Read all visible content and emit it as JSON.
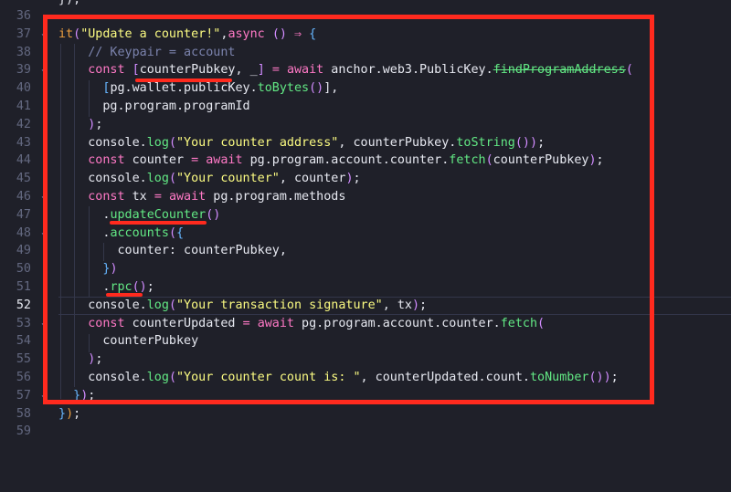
{
  "editor": {
    "partial_top": "});",
    "lines": [
      {
        "n": "36",
        "t": []
      },
      {
        "n": "37",
        "t": [
          [
            "pb",
            "it"
          ],
          [
            "pp",
            "("
          ],
          [
            "str",
            "\"Update a counter!\""
          ],
          [
            "",
            ","
          ],
          [
            "kw",
            "async"
          ],
          [
            "",
            " "
          ],
          [
            "pp",
            "()"
          ],
          [
            "",
            " "
          ],
          [
            "kw",
            "⇒"
          ],
          [
            "",
            " "
          ],
          [
            "pbl",
            "{"
          ]
        ]
      },
      {
        "n": "38",
        "t": [
          [
            "",
            "    "
          ],
          [
            "cm",
            "// Keypair = account"
          ]
        ]
      },
      {
        "n": "39",
        "t": [
          [
            "",
            "    "
          ],
          [
            "kw",
            "const"
          ],
          [
            "",
            " "
          ],
          [
            "pp",
            "["
          ],
          [
            "",
            "counterPubkey, _"
          ],
          [
            "pp",
            "]"
          ],
          [
            "",
            " "
          ],
          [
            "kw",
            "="
          ],
          [
            "",
            " "
          ],
          [
            "kw",
            "await"
          ],
          [
            "",
            " anchor.web3.PublicKey."
          ],
          [
            "fn strike",
            "findProgramAddress"
          ],
          [
            "pp",
            "("
          ]
        ]
      },
      {
        "n": "40",
        "t": [
          [
            "",
            "      "
          ],
          [
            "pbl",
            "["
          ],
          [
            "",
            "pg.wallet.publicKey."
          ],
          [
            "fn",
            "toBytes"
          ],
          [
            "pp",
            "()"
          ],
          [
            "",
            "],"
          ]
        ]
      },
      {
        "n": "41",
        "t": [
          [
            "",
            "      pg.program.programId"
          ]
        ]
      },
      {
        "n": "42",
        "t": [
          [
            "",
            "    "
          ],
          [
            "pp",
            ")"
          ],
          [
            "",
            ";"
          ]
        ]
      },
      {
        "n": "43",
        "t": [
          [
            "",
            "    console."
          ],
          [
            "fn",
            "log"
          ],
          [
            "pp",
            "("
          ],
          [
            "str",
            "\"Your counter address\""
          ],
          [
            "",
            ", counterPubkey."
          ],
          [
            "fn",
            "toString"
          ],
          [
            "pp",
            "()"
          ],
          [
            "pp",
            ")"
          ],
          [
            "",
            ";"
          ]
        ]
      },
      {
        "n": "44",
        "t": [
          [
            "",
            "    "
          ],
          [
            "kw",
            "const"
          ],
          [
            "",
            " counter "
          ],
          [
            "kw",
            "="
          ],
          [
            "",
            " "
          ],
          [
            "kw",
            "await"
          ],
          [
            "",
            " pg.program.account.counter."
          ],
          [
            "fn",
            "fetch"
          ],
          [
            "pp",
            "("
          ],
          [
            "",
            "counterPubkey"
          ],
          [
            "pp",
            ")"
          ],
          [
            "",
            ";"
          ]
        ]
      },
      {
        "n": "45",
        "t": [
          [
            "",
            "    console."
          ],
          [
            "fn",
            "log"
          ],
          [
            "pp",
            "("
          ],
          [
            "str",
            "\"Your counter\""
          ],
          [
            "",
            ", counter"
          ],
          [
            "pp",
            ")"
          ],
          [
            "",
            ";"
          ]
        ]
      },
      {
        "n": "46",
        "t": [
          [
            "",
            "    "
          ],
          [
            "kw",
            "const"
          ],
          [
            "",
            " tx "
          ],
          [
            "kw",
            "="
          ],
          [
            "",
            " "
          ],
          [
            "kw",
            "await"
          ],
          [
            "",
            " pg.program.methods"
          ]
        ]
      },
      {
        "n": "47",
        "t": [
          [
            "",
            "      ."
          ],
          [
            "fn",
            "updateCounter"
          ],
          [
            "pp",
            "()"
          ]
        ]
      },
      {
        "n": "48",
        "t": [
          [
            "",
            "      ."
          ],
          [
            "fn",
            "accounts"
          ],
          [
            "pp",
            "("
          ],
          [
            "pbl",
            "{"
          ]
        ]
      },
      {
        "n": "49",
        "t": [
          [
            "",
            "        counter: counterPubkey,"
          ]
        ]
      },
      {
        "n": "50",
        "t": [
          [
            "",
            "      "
          ],
          [
            "pbl",
            "}"
          ],
          [
            "pp",
            ")"
          ]
        ]
      },
      {
        "n": "51",
        "t": [
          [
            "",
            "      ."
          ],
          [
            "fn",
            "rpc"
          ],
          [
            "pp",
            "()"
          ],
          [
            "",
            ";"
          ]
        ]
      },
      {
        "n": "52",
        "t": [
          [
            "",
            "    console."
          ],
          [
            "fn",
            "log"
          ],
          [
            "pp",
            "("
          ],
          [
            "str",
            "\"Your transaction signature\""
          ],
          [
            "",
            ", tx"
          ],
          [
            "pp",
            ")"
          ],
          [
            "",
            ";"
          ]
        ]
      },
      {
        "n": "53",
        "t": [
          [
            "",
            "    "
          ],
          [
            "kw",
            "const"
          ],
          [
            "",
            " counterUpdated "
          ],
          [
            "kw",
            "="
          ],
          [
            "",
            " "
          ],
          [
            "kw",
            "await"
          ],
          [
            "",
            " pg.program.account.counter."
          ],
          [
            "fn",
            "fetch"
          ],
          [
            "pp",
            "("
          ]
        ]
      },
      {
        "n": "54",
        "t": [
          [
            "",
            "      counterPubkey"
          ]
        ]
      },
      {
        "n": "55",
        "t": [
          [
            "",
            "    "
          ],
          [
            "pp",
            ")"
          ],
          [
            "",
            ";"
          ]
        ]
      },
      {
        "n": "56",
        "t": [
          [
            "",
            "    console."
          ],
          [
            "fn",
            "log"
          ],
          [
            "pp",
            "("
          ],
          [
            "str",
            "\"Your counter count is: \""
          ],
          [
            "",
            ", counterUpdated.count."
          ],
          [
            "fn",
            "toNumber"
          ],
          [
            "pp",
            "()"
          ],
          [
            "pp",
            ")"
          ],
          [
            "",
            ";"
          ]
        ]
      },
      {
        "n": "57",
        "t": [
          [
            "",
            "  "
          ],
          [
            "pbl",
            "}"
          ],
          [
            "pp",
            ")"
          ],
          [
            "",
            ";"
          ]
        ]
      },
      {
        "n": "58",
        "t": [
          [
            "pbl",
            "}"
          ],
          [
            "pb",
            ")"
          ],
          [
            "",
            ";"
          ]
        ]
      },
      {
        "n": "59",
        "t": []
      }
    ],
    "active_line": "52",
    "fold_lines": [
      "37",
      "39",
      "46",
      "48",
      "53",
      "57"
    ]
  },
  "colors": {
    "background": "#1f2029",
    "annotation_red": "#ff2a1e",
    "keyword": "#ff79c6",
    "string": "#fcfc82",
    "function": "#62e884"
  }
}
